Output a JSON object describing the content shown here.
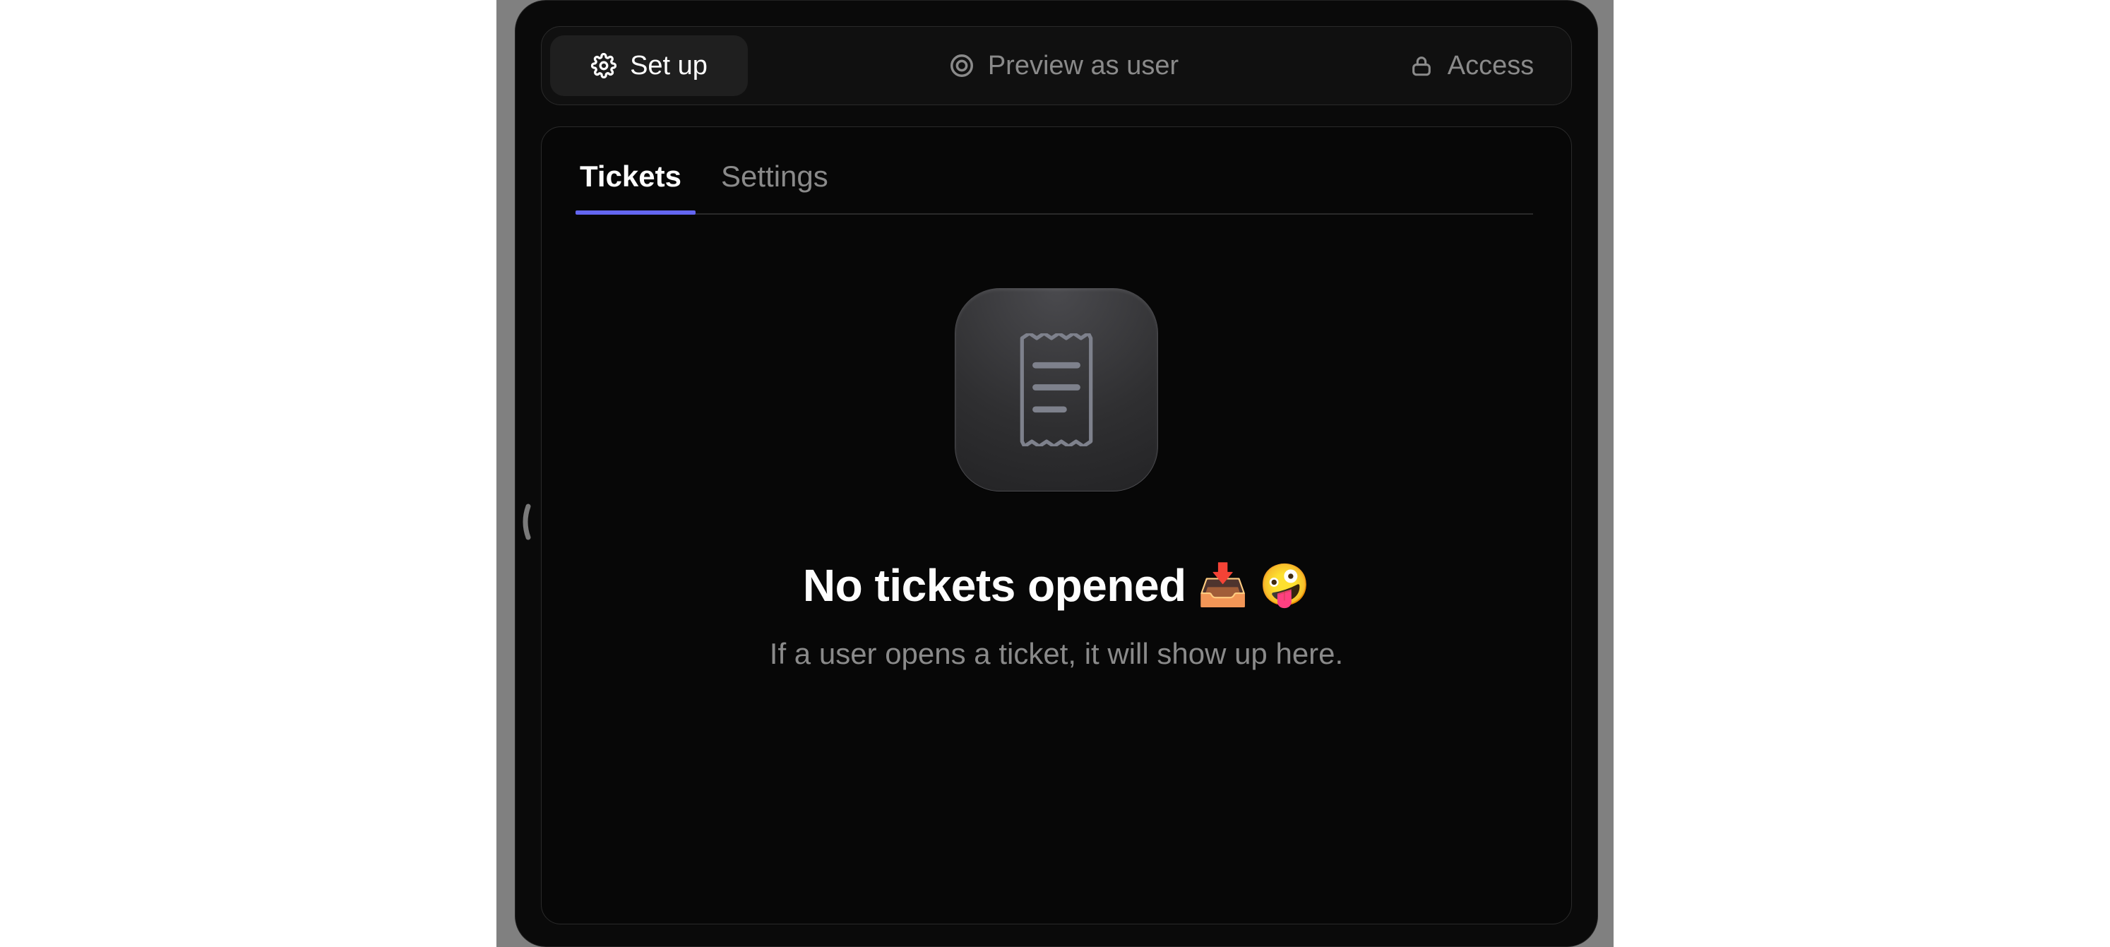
{
  "toolbar": {
    "setup_label": "Set up",
    "preview_label": "Preview as user",
    "access_label": "Access",
    "active": "setup"
  },
  "tabs": {
    "items": [
      {
        "id": "tickets",
        "label": "Tickets",
        "active": true
      },
      {
        "id": "settings",
        "label": "Settings",
        "active": false
      }
    ]
  },
  "empty_state": {
    "title": "No tickets opened",
    "emoji_inbox": "📥",
    "emoji_face": "🤪",
    "subtitle": "If a user opens a ticket, it will show up here."
  },
  "colors": {
    "card_bg": "#0a0a0a",
    "toolbar_bg": "#101010",
    "active_pill": "#1f1f1f",
    "border": "#2a2a2a",
    "text_primary": "#fdfdfd",
    "text_muted": "#8a8a8a",
    "accent": "#6366f1"
  }
}
